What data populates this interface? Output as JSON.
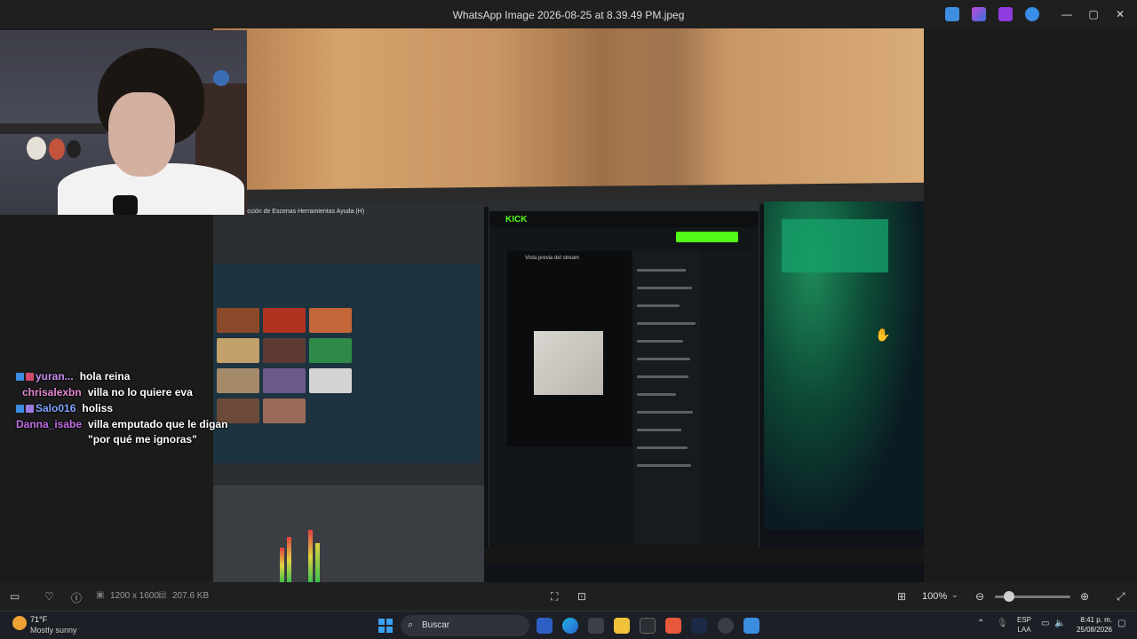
{
  "window": {
    "title": "WhatsApp Image 2026-08-25 at 8.39.49 PM.jpeg",
    "minimize_glyph": "—",
    "maximize_glyph": "▢",
    "close_glyph": "✕"
  },
  "title_icons": [
    {
      "name": "edit-image-icon",
      "color": "#3f8de0"
    },
    {
      "name": "copilot-icon",
      "color": "#c04bd6"
    },
    {
      "name": "clipchamp-icon",
      "color": "#8e3ce0"
    },
    {
      "name": "onedrive-icon",
      "color": "#3b8ee8"
    }
  ],
  "stream_chat": [
    {
      "user": "yuran...",
      "color": "#c98cf0",
      "message": "hola reina",
      "badges": [
        "#3b8de0",
        "#d04a6a"
      ]
    },
    {
      "user": "chrisalexbn",
      "color": "#e889d2",
      "message": "villa no lo quiere eva",
      "badges": []
    },
    {
      "user": "Salo016",
      "color": "#7fa6ff",
      "message": "holiss",
      "badges": [
        "#3b8de0",
        "#9c7ae0"
      ]
    },
    {
      "user": "Danna_isabe",
      "color": "#c16ee6",
      "message": "villa emputado que le digan \"por qué me ignoras\"",
      "badges": []
    }
  ],
  "photo_screen": {
    "obs_menu": "Perfil   Colección de Escenas   Herramientas   Ayuda (H)",
    "kick_logo": "KICK",
    "kick_preview_title": "Vista previa del stream"
  },
  "toolbar": {
    "dimensions": "1200 x 1600",
    "file_size": "207.6 KB",
    "zoom": "100%"
  },
  "taskbar": {
    "temperature": "71°F",
    "weather": "Mostly sunny",
    "search_placeholder": "Buscar",
    "lang_line1": "ESP",
    "lang_line2": "LAA",
    "time": "8:41 p. m.",
    "date": "25/08/2026"
  }
}
